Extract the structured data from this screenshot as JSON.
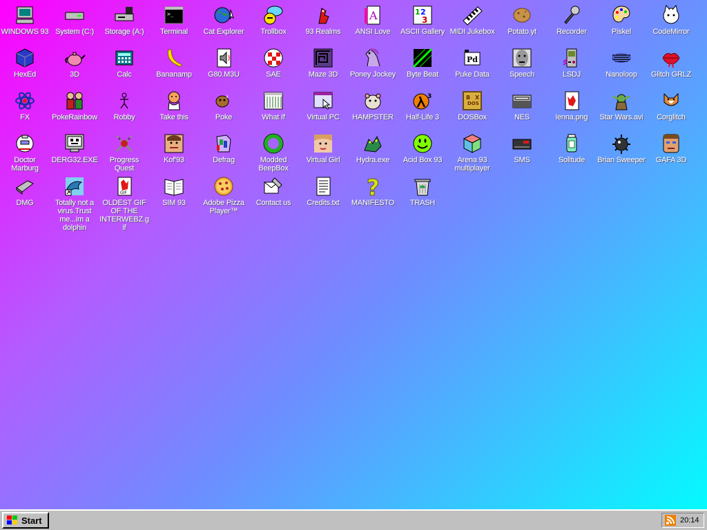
{
  "desktop": {
    "icons": [
      {
        "label": "WINDOWS 93",
        "icon": "computer-icon"
      },
      {
        "label": "System (C:)",
        "icon": "drive-icon"
      },
      {
        "label": "Storage (A:)",
        "icon": "floppy-drive-icon"
      },
      {
        "label": "Terminal",
        "icon": "terminal-icon"
      },
      {
        "label": "Cat Explorer",
        "icon": "globe-icon"
      },
      {
        "label": "Trollbox",
        "icon": "chat-smiley-icon"
      },
      {
        "label": "93 Realms",
        "icon": "dragon-icon"
      },
      {
        "label": "ANSI Love",
        "icon": "ansi-letter-icon"
      },
      {
        "label": "ASCII Gallery",
        "icon": "numbers-icon"
      },
      {
        "label": "MIDI Jukebox",
        "icon": "piano-icon"
      },
      {
        "label": "Potato.yt",
        "icon": "potato-icon"
      },
      {
        "label": "Recorder",
        "icon": "microphone-icon"
      },
      {
        "label": "Piskel",
        "icon": "palette-icon"
      },
      {
        "label": "CodeMirror",
        "icon": "cat-icon"
      },
      {
        "label": "HexEd",
        "icon": "cube-icon"
      },
      {
        "label": "3D",
        "icon": "teapot-icon"
      },
      {
        "label": "Calc",
        "icon": "calculator-icon"
      },
      {
        "label": "Bananamp",
        "icon": "banana-icon"
      },
      {
        "label": "G80.M3U",
        "icon": "speaker-file-icon"
      },
      {
        "label": "SAE",
        "icon": "amiga-ball-icon"
      },
      {
        "label": "Maze 3D",
        "icon": "maze-icon"
      },
      {
        "label": "Poney Jockey",
        "icon": "pony-icon"
      },
      {
        "label": "Byte Beat",
        "icon": "bytebeat-icon"
      },
      {
        "label": "Puke Data",
        "icon": "pd-icon"
      },
      {
        "label": "Speech",
        "icon": "face-icon"
      },
      {
        "label": "LSDJ",
        "icon": "gameboy-icon"
      },
      {
        "label": "Nanoloop",
        "icon": "wave-icon"
      },
      {
        "label": "Glitch GRLZ",
        "icon": "lips-icon"
      },
      {
        "label": "FX",
        "icon": "atom-icon"
      },
      {
        "label": "PokeRainbow",
        "icon": "trainers-icon"
      },
      {
        "label": "Robby",
        "icon": "stickman-icon"
      },
      {
        "label": "Take this",
        "icon": "man-icon"
      },
      {
        "label": "Poke",
        "icon": "pokemon-icon"
      },
      {
        "label": "What If",
        "icon": "window-grid-icon"
      },
      {
        "label": "Virtual PC",
        "icon": "window-cursor-icon"
      },
      {
        "label": "HAMPSTER",
        "icon": "hamster-icon"
      },
      {
        "label": "Half-Life 3",
        "icon": "lambda-icon"
      },
      {
        "label": "DOSBox",
        "icon": "dosbox-icon"
      },
      {
        "label": "NES",
        "icon": "nes-icon"
      },
      {
        "label": "lenna.png",
        "icon": "image-file-icon"
      },
      {
        "label": "Star Wars.avi",
        "icon": "yoda-icon"
      },
      {
        "label": "Corglitch",
        "icon": "corgi-icon"
      },
      {
        "label": "Doctor Marburg",
        "icon": "doctor-icon"
      },
      {
        "label": "DERG32.EXE",
        "icon": "monitor-face-icon"
      },
      {
        "label": "Progress Quest",
        "icon": "swords-icon"
      },
      {
        "label": "Kof'93",
        "icon": "fighter-icon"
      },
      {
        "label": "Defrag",
        "icon": "defrag-icon"
      },
      {
        "label": "Modded BeepBox",
        "icon": "ring-icon"
      },
      {
        "label": "Virtual Girl",
        "icon": "girl-face-icon"
      },
      {
        "label": "Hydra.exe",
        "icon": "hydra-icon"
      },
      {
        "label": "Acid Box 93",
        "icon": "acid-smiley-icon"
      },
      {
        "label": "Arena 93 multiplayer",
        "icon": "color-cube-icon"
      },
      {
        "label": "SMS",
        "icon": "console-icon"
      },
      {
        "label": "Solitude",
        "icon": "jar-icon"
      },
      {
        "label": "Brian Sweeper",
        "icon": "mine-icon"
      },
      {
        "label": "GAFA 3D",
        "icon": "soldier-face-icon"
      },
      {
        "label": "DMG",
        "icon": "usb-drive-icon"
      },
      {
        "label": "Totally not a virus.Trust me...im a dolphin",
        "icon": "dolphin-icon"
      },
      {
        "label": "OLDEST GIF OF THE INTERWEBZ.gif",
        "icon": "gif-file-icon"
      },
      {
        "label": "SIM 93",
        "icon": "book-icon"
      },
      {
        "label": "Adobe Pizza Player™",
        "icon": "pizza-icon"
      },
      {
        "label": "Contact us",
        "icon": "letter-icon"
      },
      {
        "label": "Credits.txt",
        "icon": "text-file-icon"
      },
      {
        "label": "MANIFESTO",
        "icon": "question-icon"
      },
      {
        "label": "TRASH",
        "icon": "trash-icon"
      }
    ]
  },
  "taskbar": {
    "start_label": "Start",
    "clock": "20:14"
  }
}
